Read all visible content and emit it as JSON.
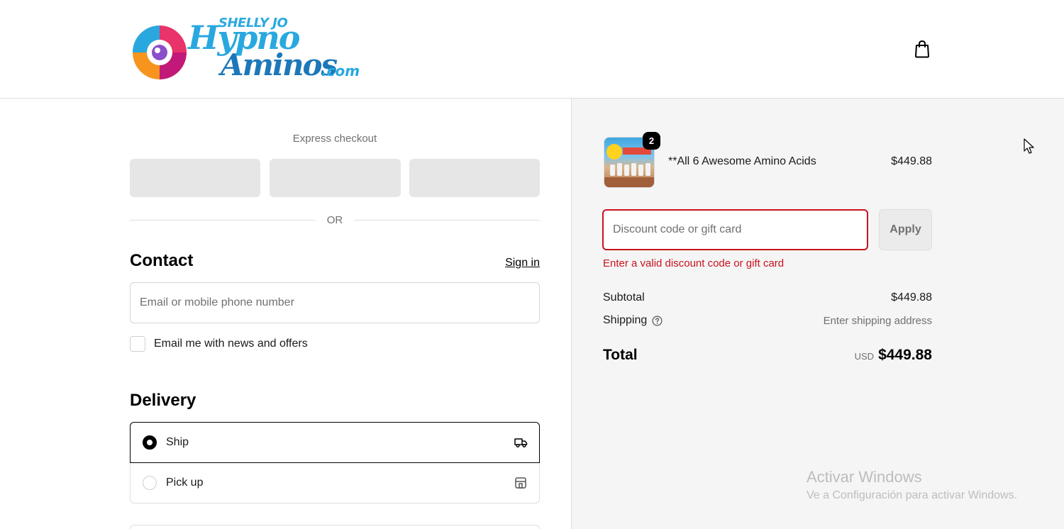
{
  "header": {
    "logo": {
      "top": "SHELLY JO",
      "main": "Hypno",
      "second": "Aminos",
      "suffix": ".com"
    },
    "cart_icon": "shopping-bag-icon"
  },
  "express": {
    "title": "Express checkout",
    "or_label": "OR"
  },
  "contact": {
    "title": "Contact",
    "signin_label": "Sign in",
    "email_placeholder": "Email or mobile phone number",
    "newsletter_label": "Email me with news and offers"
  },
  "delivery": {
    "title": "Delivery",
    "options": [
      {
        "label": "Ship",
        "selected": true,
        "icon": "truck-icon"
      },
      {
        "label": "Pick up",
        "selected": false,
        "icon": "store-icon"
      }
    ]
  },
  "order": {
    "product": {
      "name": "**All 6 Awesome Amino Acids",
      "price": "$449.88",
      "quantity": "2"
    },
    "discount": {
      "placeholder": "Discount code or gift card",
      "apply_label": "Apply",
      "error": "Enter a valid discount code or gift card"
    },
    "subtotal_label": "Subtotal",
    "subtotal_value": "$449.88",
    "shipping_label": "Shipping",
    "shipping_value": "Enter shipping address",
    "total_label": "Total",
    "total_currency": "USD",
    "total_value": "$449.88"
  },
  "windows_watermark": {
    "title": "Activar Windows",
    "subtitle": "Ve a Configuración para activar Windows."
  },
  "colors": {
    "error": "#c7131f",
    "summary_bg": "#f5f5f5",
    "logo_light_blue": "#29a8df",
    "logo_dark_blue": "#1c78b8"
  }
}
